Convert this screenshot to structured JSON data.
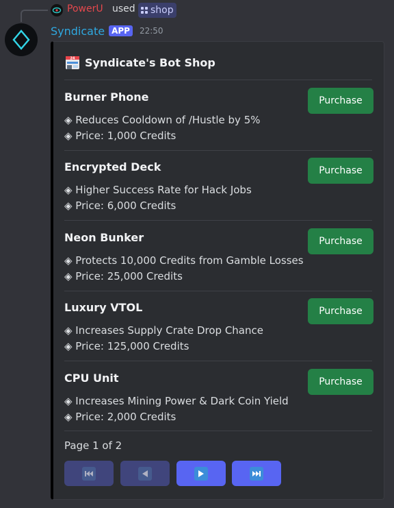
{
  "reply": {
    "user": "PowerU",
    "used_text": "used",
    "command": "shop"
  },
  "message": {
    "author": "Syndicate",
    "badge": "APP",
    "time": "22:50"
  },
  "embed": {
    "title_icon": "convenience-store-emoji",
    "title": "Syndicate's Bot Shop",
    "accent_color": "#000000",
    "items": [
      {
        "name": "Burner Phone",
        "effect": "◈ Reduces Cooldown of /Hustle by 5%",
        "price": "◈ Price: 1,000 Credits",
        "button": "Purchase"
      },
      {
        "name": "Encrypted Deck",
        "effect": "◈ Higher Success Rate for Hack Jobs",
        "price": "◈ Price: 6,000 Credits",
        "button": "Purchase"
      },
      {
        "name": "Neon Bunker",
        "effect": "◈ Protects 10,000 Credits from Gamble Losses",
        "price": "◈ Price: 25,000 Credits",
        "button": "Purchase"
      },
      {
        "name": "Luxury VTOL",
        "effect": "◈ Increases Supply Crate Drop Chance",
        "price": "◈ Price: 125,000 Credits",
        "button": "Purchase"
      },
      {
        "name": "CPU Unit",
        "effect": "◈ Increases Mining Power & Dark Coin Yield",
        "price": "◈ Price: 2,000 Credits",
        "button": "Purchase"
      }
    ],
    "page_label": "Page 1 of 2"
  },
  "nav": [
    {
      "icon": "first-page-icon",
      "enabled": false
    },
    {
      "icon": "previous-page-icon",
      "enabled": false
    },
    {
      "icon": "next-page-icon",
      "enabled": true
    },
    {
      "icon": "last-page-icon",
      "enabled": true
    }
  ],
  "colors": {
    "purchase_button": "#248046",
    "nav_button": "#5865f2",
    "author_name": "#2fa8e0",
    "reply_user": "#e5484d"
  }
}
